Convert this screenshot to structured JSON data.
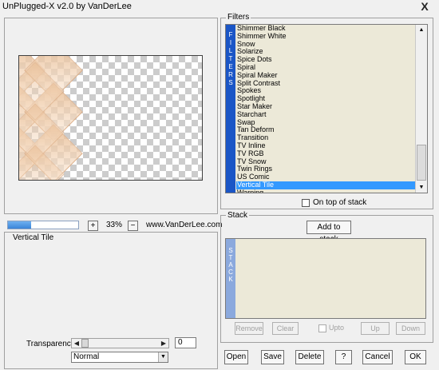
{
  "window": {
    "title": "UnPlugged-X v2.0 by VanDerLee",
    "close": "X"
  },
  "preview": {
    "progress": 0.33,
    "plus": "+",
    "zoom": "33%",
    "minus": "−",
    "website": "www.VanDerLee.com"
  },
  "params": {
    "group_label": "Vertical Tile",
    "transparency_label": "Transparency",
    "transparency_value": "0",
    "blend_mode": "Normal"
  },
  "filters": {
    "group_label": "Filters",
    "side_label": "F I L T E R S",
    "items": [
      "Shimmer Black",
      "Shimmer White",
      "Snow",
      "Solarize",
      "Spice Dots",
      "Spiral",
      "Spiral Maker",
      "Split Contrast",
      "Spokes",
      "Spotlight",
      "Star Maker",
      "Starchart",
      "Swap",
      "Tan Deform",
      "Transition",
      "TV Inline",
      "TV RGB",
      "TV Snow",
      "Twin Rings",
      "US Comic",
      "Vertical Tile",
      "Warping"
    ],
    "selected": "Vertical Tile",
    "on_top_label": "On top of stack"
  },
  "stack": {
    "group_label": "Stack",
    "add_button": "Add to stack",
    "side_label": "S T A C K",
    "remove": "Remove",
    "clear": "Clear",
    "upto": "Upto",
    "up": "Up",
    "down": "Down"
  },
  "buttons": {
    "open": "Open",
    "save": "Save",
    "delete": "Delete",
    "help": "?",
    "cancel": "Cancel",
    "ok": "OK"
  }
}
